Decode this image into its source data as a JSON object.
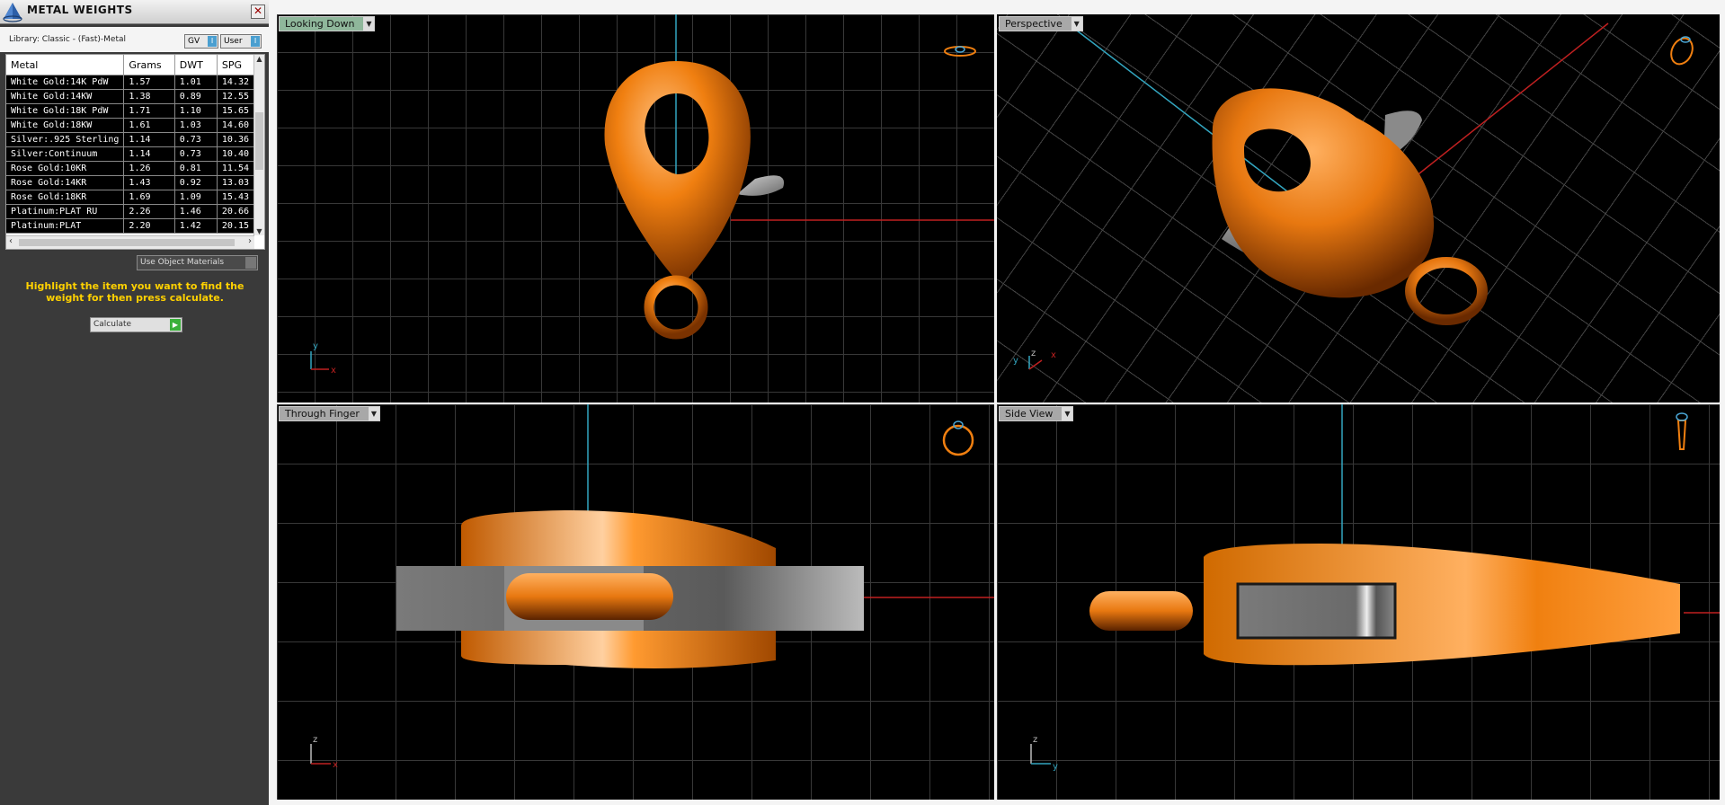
{
  "panel": {
    "title": "METAL WEIGHTS",
    "close_label": "✕",
    "library_label": "Library: Classic - (Fast)-Metal",
    "toggle_gv": "GV",
    "toggle_user": "User",
    "toggle_indicator": "I",
    "columns": [
      "Metal",
      "Grams",
      "DWT",
      "SPG"
    ],
    "rows": [
      [
        "White Gold:14K PdW",
        "1.57",
        "1.01",
        "14.32"
      ],
      [
        "White Gold:14KW",
        "1.38",
        "0.89",
        "12.55"
      ],
      [
        "White Gold:18K PdW",
        "1.71",
        "1.10",
        "15.65"
      ],
      [
        "White Gold:18KW",
        "1.61",
        "1.03",
        "14.60"
      ],
      [
        "Silver:.925 Sterling",
        "1.14",
        "0.73",
        "10.36"
      ],
      [
        "Silver:Continuum",
        "1.14",
        "0.73",
        "10.40"
      ],
      [
        "Rose Gold:10KR",
        "1.26",
        "0.81",
        "11.54"
      ],
      [
        "Rose Gold:14KR",
        "1.43",
        "0.92",
        "13.03"
      ],
      [
        "Rose Gold:18KR",
        "1.69",
        "1.09",
        "15.43"
      ],
      [
        "Platinum:PLAT RU",
        "2.26",
        "1.46",
        "20.66"
      ],
      [
        "Platinum:PLAT",
        "2.20",
        "1.42",
        "20.15"
      ]
    ],
    "use_object_materials": "Use Object Materials",
    "hint": "Highlight the item you want to find the weight for then press calculate.",
    "calculate_label": "Calculate"
  },
  "viewports": {
    "top": {
      "label": "Looking Down",
      "axis_a": "y",
      "axis_b": "x"
    },
    "perspective": {
      "label": "Perspective",
      "axis_a": "y",
      "axis_b": "z",
      "axis_c": "x"
    },
    "front": {
      "label": "Through Finger",
      "axis_a": "z",
      "axis_b": "x"
    },
    "side": {
      "label": "Side View",
      "axis_a": "z",
      "axis_b": "y"
    }
  },
  "colors": {
    "metal": "#f07f10",
    "insert": "#8a8a8a",
    "axis_red": "#c02020",
    "axis_cyan": "#33a6c0",
    "grid": "#383838"
  },
  "icons": {
    "logo": "pyramid-logo-icon",
    "ring": "ring-orientation-icon",
    "dropdown": "chevron-down-icon"
  }
}
